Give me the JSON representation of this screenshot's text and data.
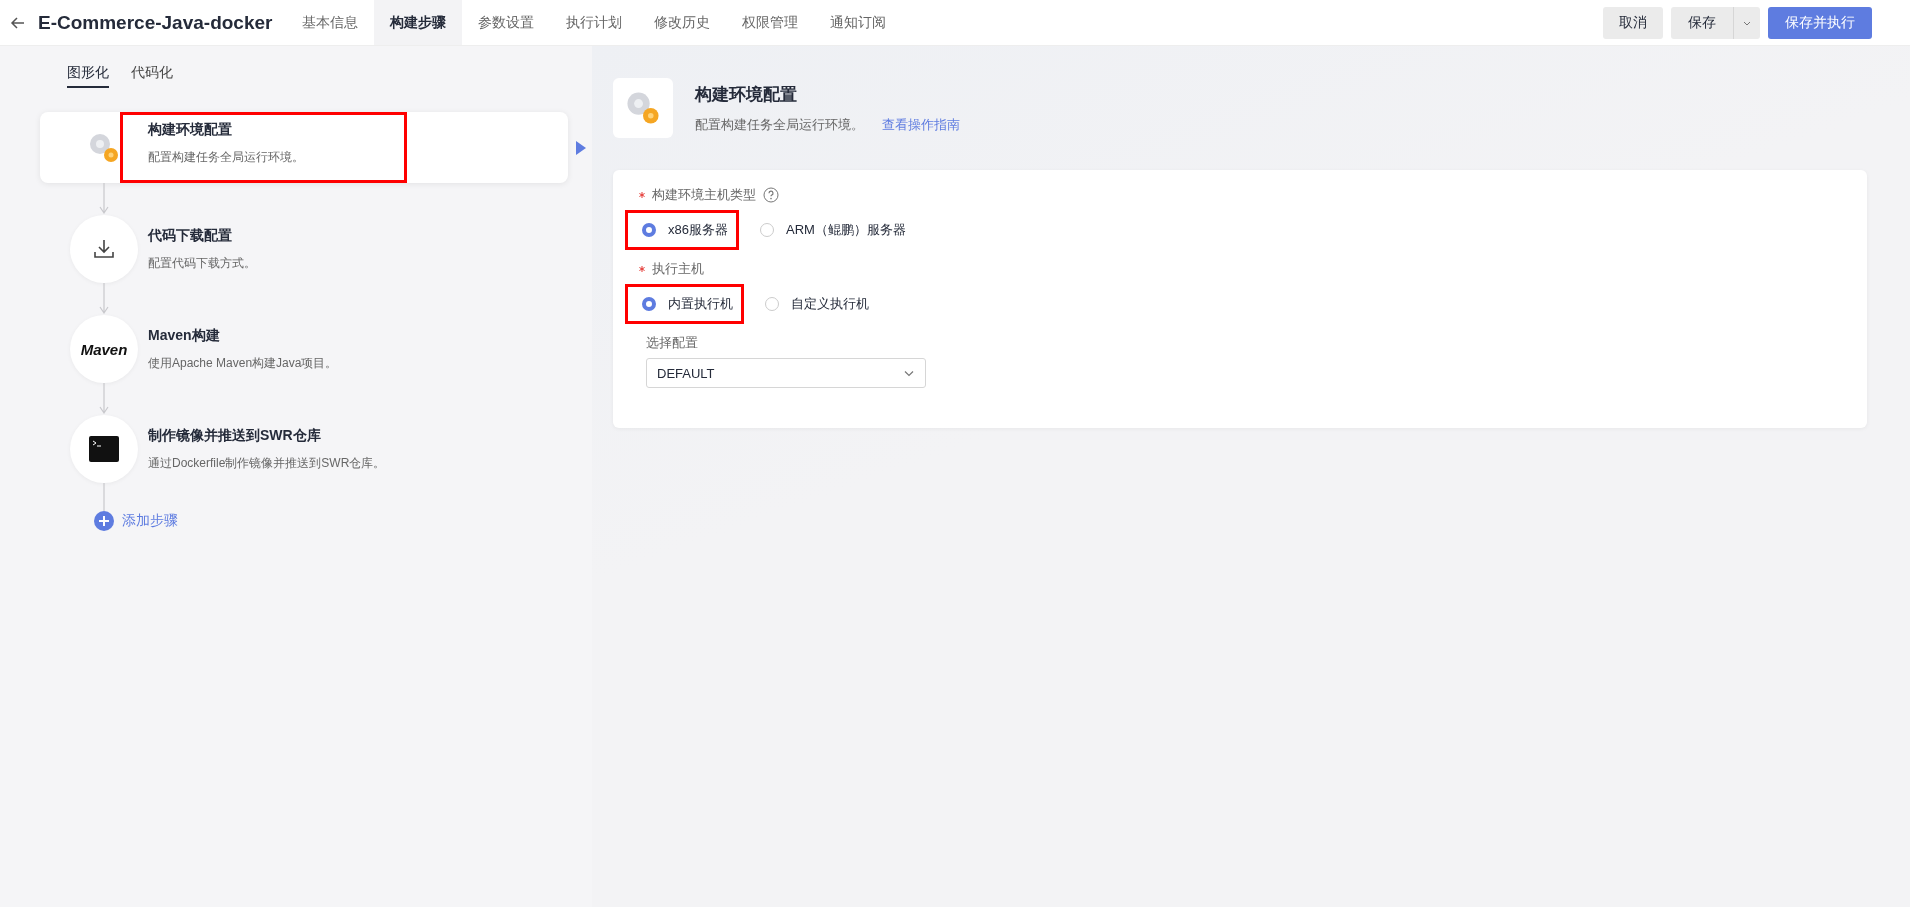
{
  "header": {
    "title": "E-Commerce-Java-docker",
    "tabs": [
      {
        "label": "基本信息",
        "selected": false
      },
      {
        "label": "构建步骤",
        "selected": true
      },
      {
        "label": "参数设置",
        "selected": false
      },
      {
        "label": "执行计划",
        "selected": false
      },
      {
        "label": "修改历史",
        "selected": false
      },
      {
        "label": "权限管理",
        "selected": false
      },
      {
        "label": "通知订阅",
        "selected": false
      }
    ],
    "buttons": {
      "cancel": "取消",
      "save": "保存",
      "save_run": "保存并执行"
    }
  },
  "mode_tabs": [
    {
      "label": "图形化",
      "selected": true
    },
    {
      "label": "代码化",
      "selected": false
    }
  ],
  "steps": [
    {
      "kind": "env",
      "title": "构建环境配置",
      "description": "配置构建任务全局运行环境。",
      "selected": true,
      "annotated": true
    },
    {
      "kind": "download",
      "title": "代码下载配置",
      "description": "配置代码下载方式。",
      "selected": false,
      "annotated": false
    },
    {
      "kind": "maven",
      "logo_text": "Maven",
      "title": "Maven构建",
      "description": "使用Apache Maven构建Java项目。",
      "selected": false,
      "annotated": false
    },
    {
      "kind": "terminal",
      "title": "制作镜像并推送到SWR仓库",
      "description": "通过Dockerfile制作镜像并推送到SWR仓库。",
      "selected": false,
      "annotated": false
    }
  ],
  "add_step": "添加步骤",
  "detail": {
    "title": "构建环境配置",
    "description": "配置构建任务全局运行环境。",
    "guide_link": "查看操作指南",
    "fields": [
      {
        "label": "构建环境主机类型",
        "required": true,
        "help": true,
        "options": [
          {
            "label": "x86服务器",
            "selected": true,
            "annotated": true
          },
          {
            "label": "ARM（鲲鹏）服务器",
            "selected": false,
            "annotated": false
          }
        ]
      },
      {
        "label": "执行主机",
        "required": true,
        "help": false,
        "options": [
          {
            "label": "内置执行机",
            "selected": true,
            "annotated": true
          },
          {
            "label": "自定义执行机",
            "selected": false,
            "annotated": false
          }
        ]
      }
    ],
    "select": {
      "label": "选择配置",
      "value": "DEFAULT"
    }
  }
}
